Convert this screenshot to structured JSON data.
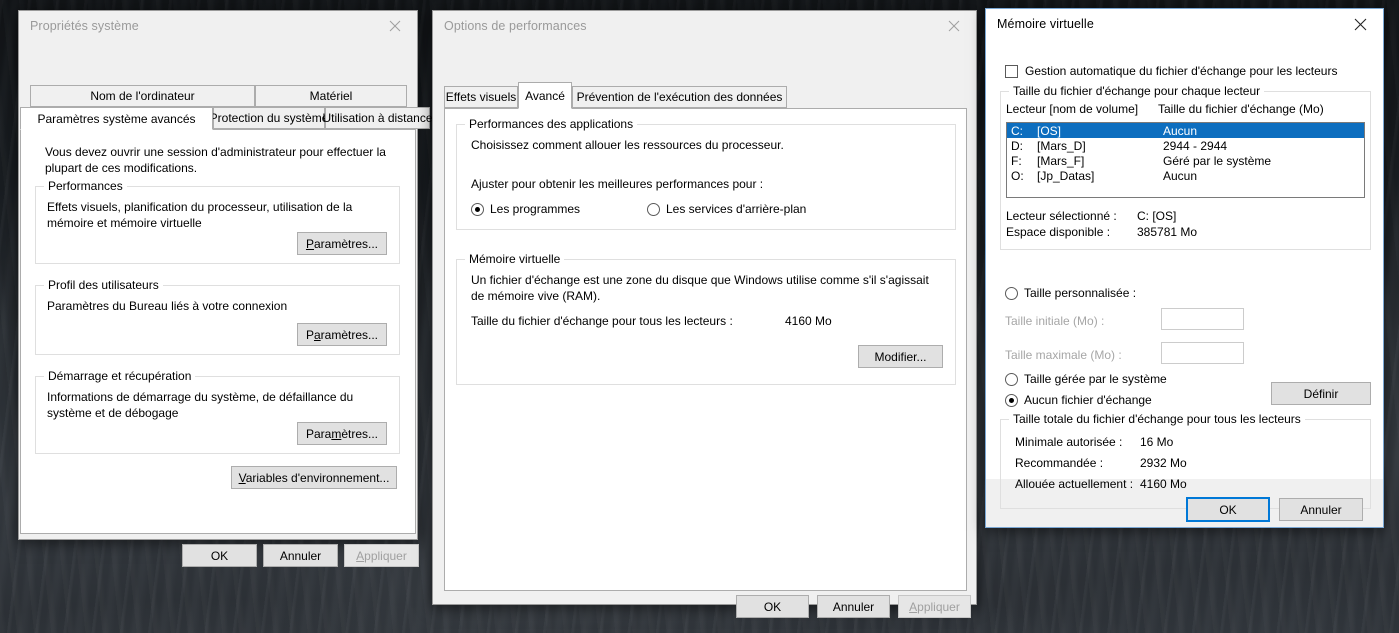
{
  "desktop": {
    "wallpaper_name": "dark-ocean-waves"
  },
  "dialog_system_properties": {
    "title": "Propriétés système",
    "close_icon": "close-icon",
    "tabs_row1": [
      {
        "label": "Nom de l'ordinateur",
        "selected": false
      },
      {
        "label": "Matériel",
        "selected": false
      }
    ],
    "tabs_row2": [
      {
        "label": "Paramètres système avancés",
        "selected": true
      },
      {
        "label": "Protection du système",
        "selected": false
      },
      {
        "label": "Utilisation à distance",
        "selected": false
      }
    ],
    "notice": "Vous devez ouvrir une session d'administrateur pour effectuer la plupart de ces modifications.",
    "groups": [
      {
        "legend": "Performances",
        "body": "Effets visuels, planification du processeur, utilisation de la mémoire et mémoire virtuelle",
        "button": "Paramètres...",
        "button_accel_index": 1
      },
      {
        "legend": "Profil des utilisateurs",
        "body": "Paramètres du Bureau liés à votre connexion",
        "button": "Paramètres...",
        "button_accel_index": 1
      },
      {
        "legend": "Démarrage et récupération",
        "body": "Informations de démarrage du système, de défaillance du système et de débogage",
        "button": "Paramètres...",
        "button_accel_index": 4
      }
    ],
    "env_button": "Variables d'environnement...",
    "footer": {
      "ok": "OK",
      "cancel": "Annuler",
      "apply": "Appliquer",
      "apply_disabled": true
    }
  },
  "dialog_performance_options": {
    "title": "Options de performances",
    "close_icon": "close-icon",
    "tabs": [
      {
        "label": "Effets visuels",
        "selected": false
      },
      {
        "label": "Avancé",
        "selected": true
      },
      {
        "label": "Prévention de l'exécution des données",
        "selected": false
      }
    ],
    "group_apps": {
      "legend": "Performances des applications",
      "line1": "Choisissez comment allouer les ressources du processeur.",
      "line2": "Ajuster pour obtenir les meilleures performances pour :",
      "radio_programs": "Les programmes",
      "radio_background": "Les services d'arrière-plan",
      "selected": "programs"
    },
    "group_vm": {
      "legend": "Mémoire virtuelle",
      "description": "Un fichier d'échange est une zone du disque que Windows utilise comme s'il s'agissait de mémoire vive (RAM).",
      "total_label": "Taille du fichier d'échange pour tous les lecteurs :",
      "total_value": "4160 Mo",
      "change_button": "Modifier..."
    },
    "footer": {
      "ok": "OK",
      "cancel": "Annuler",
      "apply": "Appliquer",
      "apply_disabled": true
    }
  },
  "dialog_virtual_memory": {
    "title": "Mémoire virtuelle",
    "close_icon": "close-icon",
    "auto_manage": {
      "label": "Gestion automatique du fichier d'échange pour les lecteurs",
      "checked": false
    },
    "group_per_drive": {
      "legend": "Taille du fichier d'échange pour chaque lecteur",
      "columns": [
        "Lecteur [nom de volume]",
        "Taille du fichier d'échange (Mo)"
      ],
      "rows": [
        {
          "drive": "C:",
          "volume": "[OS]",
          "size": "Aucun",
          "selected": true
        },
        {
          "drive": "D:",
          "volume": "[Mars_D]",
          "size": "2944 - 2944",
          "selected": false
        },
        {
          "drive": "F:",
          "volume": "[Mars_F]",
          "size": "Géré par le système",
          "selected": false
        },
        {
          "drive": "O:",
          "volume": "[Jp_Datas]",
          "size": "Aucun",
          "selected": false
        }
      ],
      "selected_drive_label": "Lecteur sélectionné :",
      "selected_drive_value": "C:  [OS]",
      "free_space_label": "Espace disponible :",
      "free_space_value": "385781 Mo",
      "radio_custom": "Taille personnalisée :",
      "initial_size_label": "Taille initiale (Mo) :",
      "initial_size_value": "",
      "max_size_label": "Taille maximale (Mo) :",
      "max_size_value": "",
      "radio_system_managed": "Taille gérée par le système",
      "radio_none": "Aucun fichier d'échange",
      "selected_option": "none",
      "set_button": "Définir"
    },
    "group_total": {
      "legend": "Taille totale du fichier d'échange pour tous les lecteurs",
      "rows": [
        {
          "label": "Minimale autorisée :",
          "value": "16 Mo"
        },
        {
          "label": "Recommandée :",
          "value": "2932 Mo"
        },
        {
          "label": "Allouée actuellement :",
          "value": "4160 Mo"
        }
      ]
    },
    "footer": {
      "ok": "OK",
      "cancel": "Annuler",
      "ok_is_default": true
    }
  },
  "colors": {
    "accent": "#0078d7",
    "selection": "#0d6ebf",
    "dialog_bg": "#f0f0f0",
    "page_bg": "#ffffff",
    "button_bg": "#e1e1e1",
    "disabled_text": "#a0a0a0"
  }
}
